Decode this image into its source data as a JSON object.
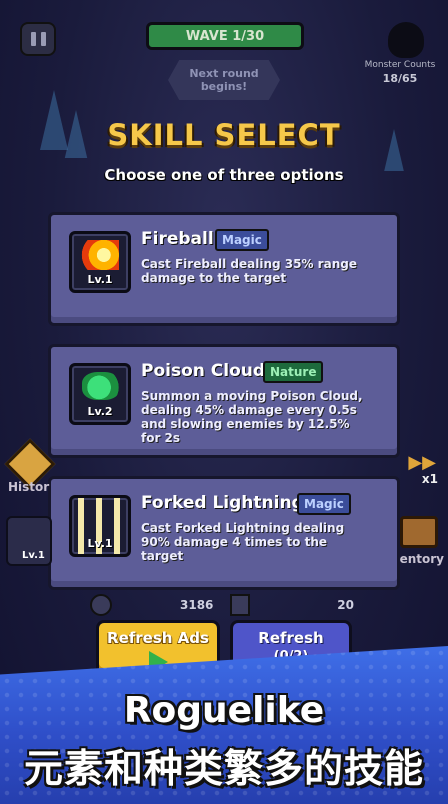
{
  "hud": {
    "wave": "WAVE 1/30",
    "next_round_line1": "Next round",
    "next_round_line2": "begins!",
    "monster_counts_label": "Monster Counts",
    "monster_counts_value": "18/65",
    "history_label": "Histor",
    "speed_label": "x1",
    "inventory_label": "entory",
    "left_slot_level": "Lv.1",
    "stat_value_1": "3186",
    "stat_value_2": "20"
  },
  "header": {
    "title": "SKILL SELECT",
    "subtitle": "Choose one of three options"
  },
  "skills": [
    {
      "name": "Fireball",
      "tag": "Magic",
      "level": "Lv.1",
      "icon": "fireball-icon",
      "description": "Cast Fireball dealing 35% range damage to the target"
    },
    {
      "name": "Poison Cloud",
      "tag": "Nature",
      "level": "Lv.2",
      "icon": "poison-cloud-icon",
      "description": "Summon a moving Poison Cloud, dealing 45% damage every 0.5s and slowing enemies by 12.5% for 2s"
    },
    {
      "name": "Forked Lightning",
      "tag": "Magic",
      "level": "Lv.1",
      "icon": "forked-lightning-icon",
      "description": "Cast Forked Lightning dealing 90% damage 4 times to the target"
    }
  ],
  "buttons": {
    "refresh_ads": "Refresh Ads",
    "refresh": "Refresh",
    "refresh_count": "(0/2)"
  },
  "banner": {
    "line1": "Roguelike",
    "line2": "元素和种类繁多的技能"
  },
  "colors": {
    "title": "#f6c84a",
    "card": "#5d5d98",
    "magic_tag": "#3b4d9a",
    "nature_tag": "#1d6a3c",
    "ads_button": "#f2c12d",
    "refresh_button": "#4f55c9",
    "banner": "#3f6fe8"
  }
}
